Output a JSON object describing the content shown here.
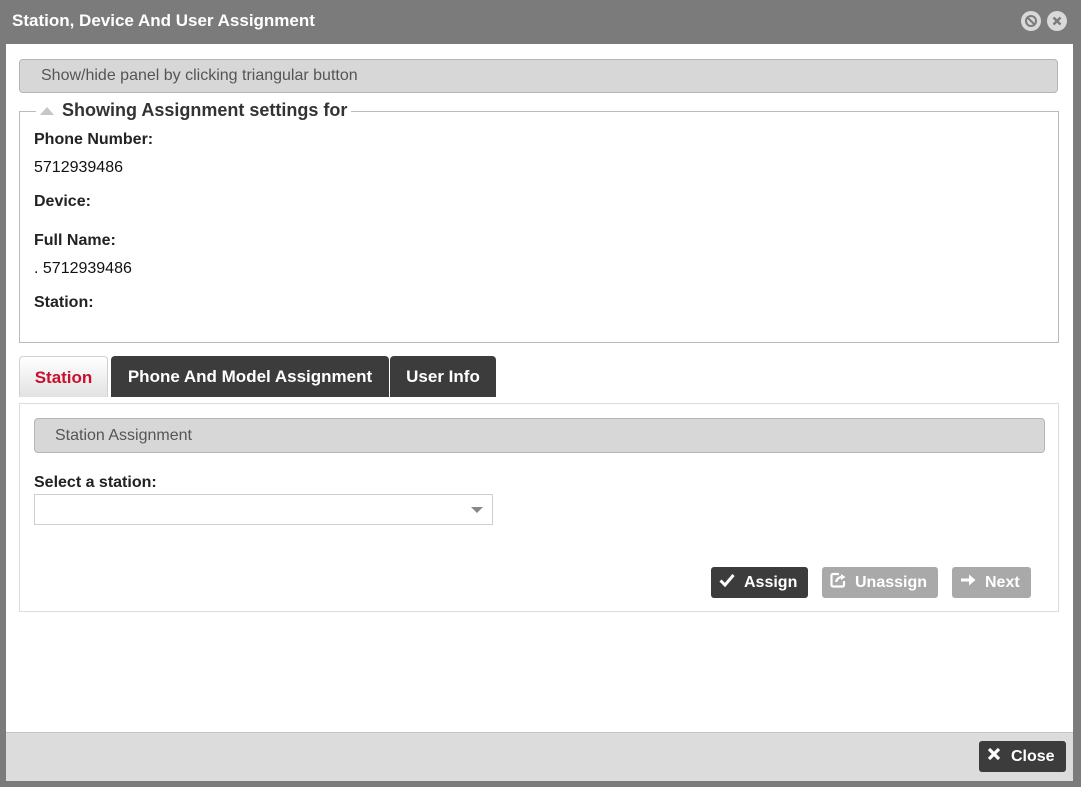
{
  "window": {
    "title": "Station, Device And User Assignment"
  },
  "hint_bar": "Show/hide panel by clicking triangular button",
  "assignment_panel": {
    "legend": "Showing Assignment settings for",
    "phone_number_label": "Phone Number:",
    "phone_number_value": "5712939486",
    "device_label": "Device:",
    "device_value": "",
    "full_name_label": "Full Name:",
    "full_name_value": ". 5712939486",
    "station_label": "Station:",
    "station_value": ""
  },
  "tabs": [
    {
      "label": "Station",
      "active": true
    },
    {
      "label": "Phone And Model Assignment",
      "active": false
    },
    {
      "label": "User Info",
      "active": false
    }
  ],
  "station_tab": {
    "section_title": "Station Assignment",
    "select_label": "Select a station:",
    "select_value": "",
    "buttons": {
      "assign": "Assign",
      "unassign": "Unassign",
      "next": "Next"
    }
  },
  "footer": {
    "close_label": "Close"
  },
  "colors": {
    "titlebar": "#7b7b7b",
    "active_tab_text": "#c8102e",
    "dark_button": "#3c3c3c",
    "disabled_button": "#a9a9a9"
  },
  "icons": {
    "minimize": "circle-slash-icon",
    "close_window": "circle-x-icon",
    "collapse": "triangle-up-icon",
    "assign": "checkmark-icon",
    "unassign": "share-icon",
    "next": "arrow-right-icon",
    "close": "x-icon"
  }
}
